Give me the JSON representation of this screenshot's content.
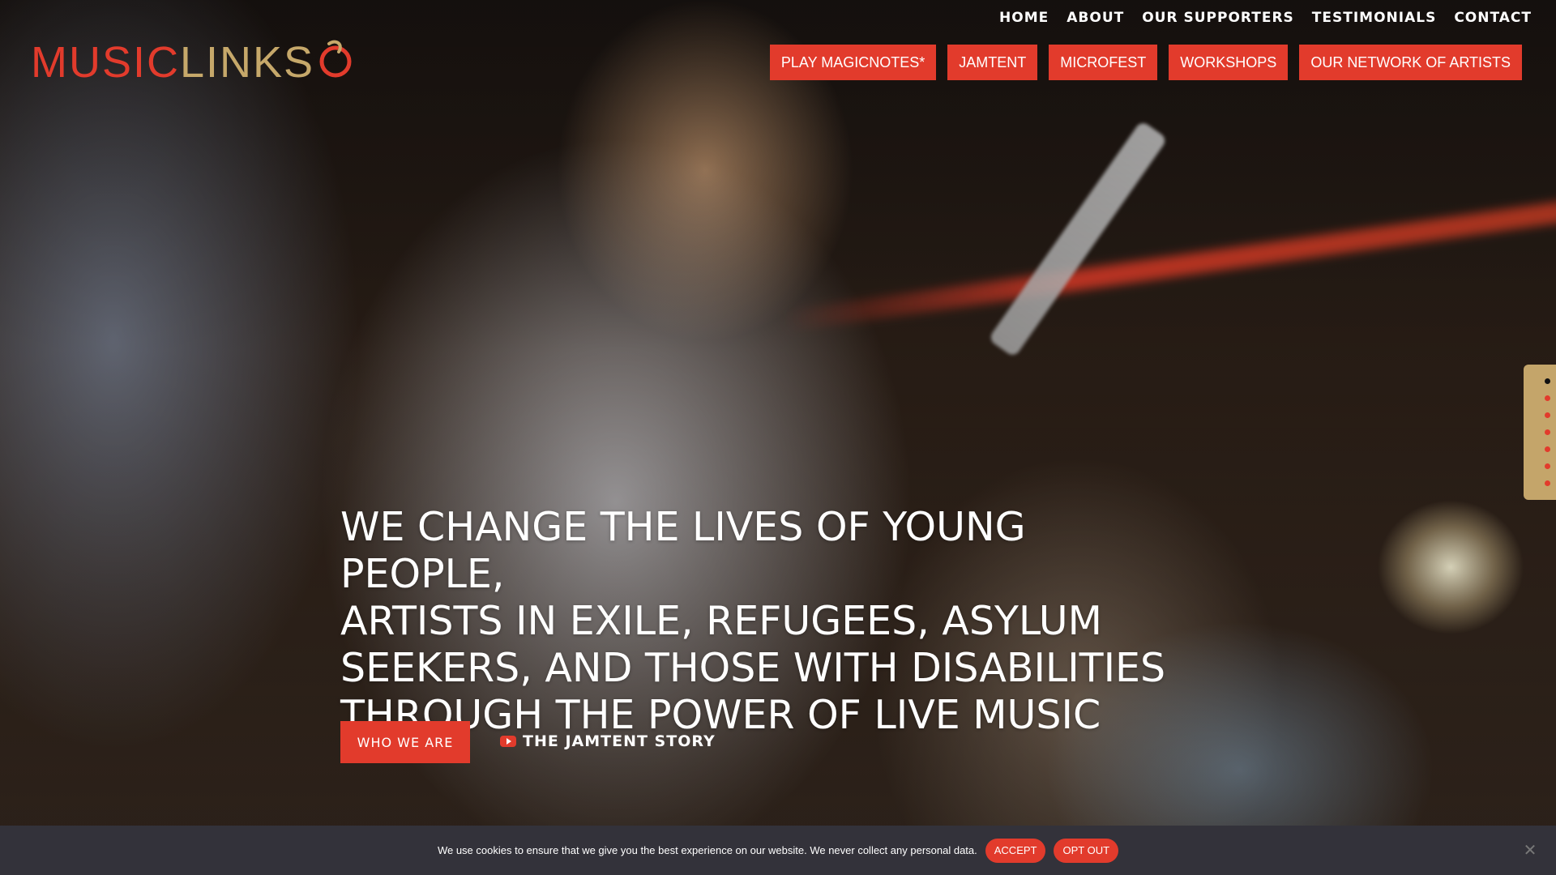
{
  "logo": {
    "part1": "MUSIC",
    "part2": "LINKS",
    "colors": {
      "music": "#e23b2c",
      "links": "#c6a86a"
    }
  },
  "top_nav": [
    {
      "label": "HOME"
    },
    {
      "label": "ABOUT"
    },
    {
      "label": "OUR SUPPORTERS"
    },
    {
      "label": "TESTIMONIALS"
    },
    {
      "label": "CONTACT"
    }
  ],
  "main_nav": [
    {
      "label": "PLAY MAGICNOTES*"
    },
    {
      "label": "JAMTENT"
    },
    {
      "label": "MICROFEST"
    },
    {
      "label": "WORKSHOPS"
    },
    {
      "label": "OUR NETWORK OF ARTISTS"
    }
  ],
  "section_dots": {
    "count": 7,
    "active_index": 0
  },
  "hero": {
    "headline_lines": [
      "WE CHANGE THE LIVES OF YOUNG PEOPLE,",
      "ARTISTS IN EXILE, REFUGEES, ASYLUM",
      "SEEKERS, AND THOSE WITH DISABILITIES",
      "THROUGH THE POWER OF LIVE MUSIC"
    ],
    "cta_label": "WHO WE ARE",
    "story_label": "THE JAMTENT STORY",
    "story_icon": "youtube-icon"
  },
  "cookie_bar": {
    "text": "We use cookies to ensure that we give you the best experience on our website. We never collect any personal data.",
    "accept_label": "ACCEPT",
    "optout_label": "OPT OUT",
    "close_icon": "close-icon"
  },
  "colors": {
    "accent": "#e23b2c",
    "gold": "#c4a56a",
    "cookie_bg": "#33323a"
  }
}
